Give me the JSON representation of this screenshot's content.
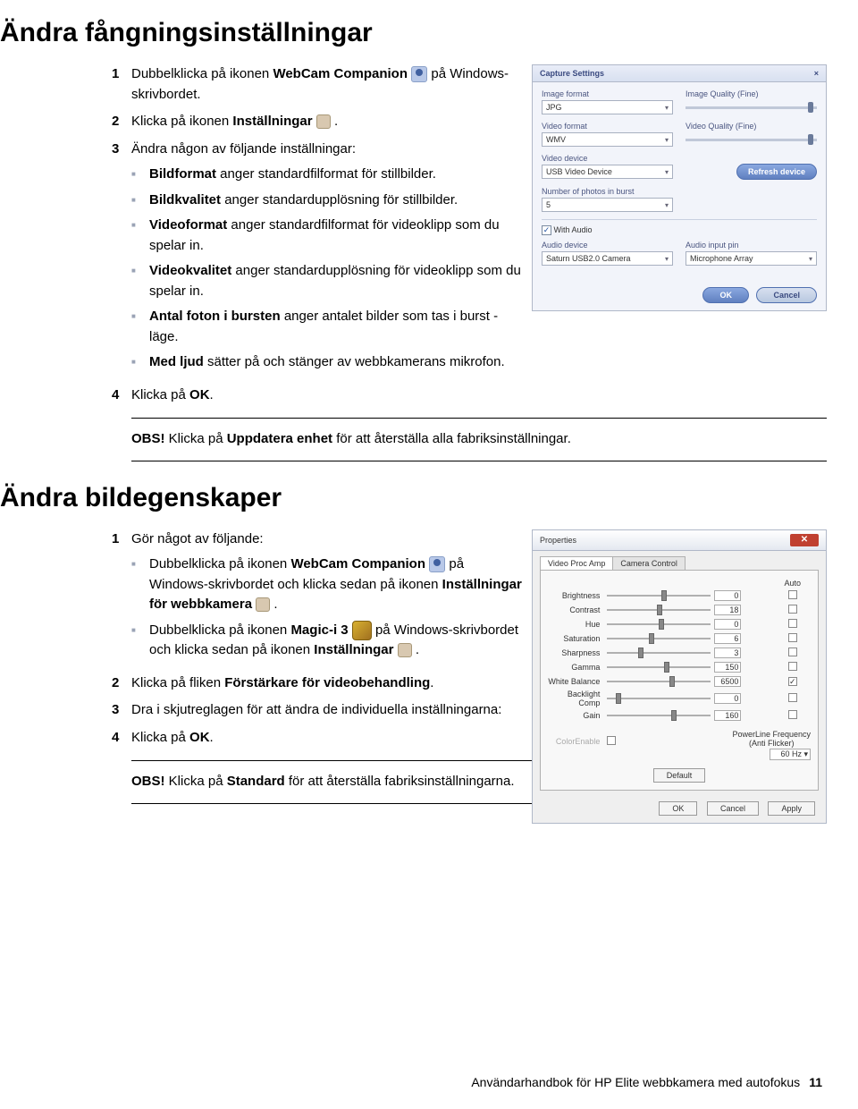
{
  "h1a": "Ändra fångningsinställningar",
  "sec1": {
    "s1a": "Dubbelklicka på ikonen ",
    "s1b": "WebCam Companion",
    "s1c": " på Windows-skrivbordet.",
    "s2a": "Klicka på ikonen ",
    "s2b": "Inställningar",
    "s2c": " .",
    "s3": "Ändra någon av följande inställningar:",
    "b1a": "Bildformat",
    "b1b": " anger standardfilformat för stillbilder.",
    "b2a": "Bildkvalitet",
    "b2b": " anger standardupplösning för stillbilder.",
    "b3a": "Videoformat",
    "b3b": " anger standardfilformat för videoklipp som du spelar in.",
    "b4a": "Videokvalitet",
    "b4b": " anger standardupplösning för videoklipp som du spelar in.",
    "b5a": "Antal foton i bursten",
    "b5b": " anger antalet bilder som tas i burst -läge.",
    "b6a": "Med ljud",
    "b6b": " sätter på och stänger av webbkamerans mikrofon.",
    "s4a": "Klicka på ",
    "s4b": "OK",
    "s4c": ".",
    "obs1a": "OBS!",
    "obs1b": " Klicka på ",
    "obs1c": "Uppdatera enhet",
    "obs1d": " för att återställa alla fabriksinställningar."
  },
  "panel1": {
    "title": "Capture Settings",
    "close": "×",
    "imgfmt_l": "Image format",
    "imgfmt_v": "JPG",
    "imgq_l": "Image Quality (Fine)",
    "vidfmt_l": "Video format",
    "vidfmt_v": "WMV",
    "vidq_l": "Video Quality (Fine)",
    "viddev_l": "Video device",
    "viddev_v": "USB Video Device",
    "refresh": "Refresh device",
    "burst_l": "Number of photos in burst",
    "burst_v": "5",
    "withaudio": "With Audio",
    "audiodev_l": "Audio device",
    "audiodev_v": "Saturn USB2.0 Camera",
    "audioin_l": "Audio input pin",
    "audioin_v": "Microphone Array",
    "ok": "OK",
    "cancel": "Cancel"
  },
  "h1b": "Ändra bildegenskaper",
  "sec2": {
    "s1": "Gör något av följande:",
    "b1a": "Dubbelklicka på ikonen ",
    "b1b": "WebCam Companion",
    "b1c": " på Windows-skrivbordet och klicka sedan på ikonen ",
    "b1d": "Inställningar för webbkamera",
    "b1e": " .",
    "b2a": "Dubbelklicka på ikonen ",
    "b2b": "Magic-i 3",
    "b2c": " på Windows-skrivbordet och klicka sedan på ikonen ",
    "b2d": "Inställningar",
    "b2e": " .",
    "s2a": "Klicka på fliken ",
    "s2b": "Förstärkare för videobehandling",
    "s2c": ".",
    "s3": "Dra i skjutreglagen för att ändra de individuella inställningarna:",
    "s4a": "Klicka på ",
    "s4b": "OK",
    "s4c": ".",
    "obs2a": "OBS!",
    "obs2b": " Klicka på ",
    "obs2c": "Standard",
    "obs2d": " för att återställa fabriksinställningarna."
  },
  "panel2": {
    "title": "Properties",
    "tab1": "Video Proc Amp",
    "tab2": "Camera Control",
    "auto": "Auto",
    "rows": [
      {
        "label": "Brightness",
        "val": "0",
        "thumb": 52,
        "chk": false
      },
      {
        "label": "Contrast",
        "val": "18",
        "thumb": 48,
        "chk": false
      },
      {
        "label": "Hue",
        "val": "0",
        "thumb": 50,
        "chk": false
      },
      {
        "label": "Saturation",
        "val": "6",
        "thumb": 40,
        "chk": false
      },
      {
        "label": "Sharpness",
        "val": "3",
        "thumb": 30,
        "chk": false
      },
      {
        "label": "Gamma",
        "val": "150",
        "thumb": 55,
        "chk": false
      },
      {
        "label": "White Balance",
        "val": "6500",
        "thumb": 60,
        "chk": true
      },
      {
        "label": "Backlight Comp",
        "val": "0",
        "thumb": 8,
        "chk": false
      },
      {
        "label": "Gain",
        "val": "160",
        "thumb": 62,
        "chk": false
      }
    ],
    "colorEnable": "ColorEnable",
    "plf1": "PowerLine Frequency",
    "plf2": "(Anti Flicker)",
    "plfv": "60 Hz",
    "def": "Default",
    "ok": "OK",
    "cancel": "Cancel",
    "apply": "Apply"
  },
  "footer_text": "Användarhandbok för HP Elite webbkamera med autofokus",
  "footer_page": "11"
}
